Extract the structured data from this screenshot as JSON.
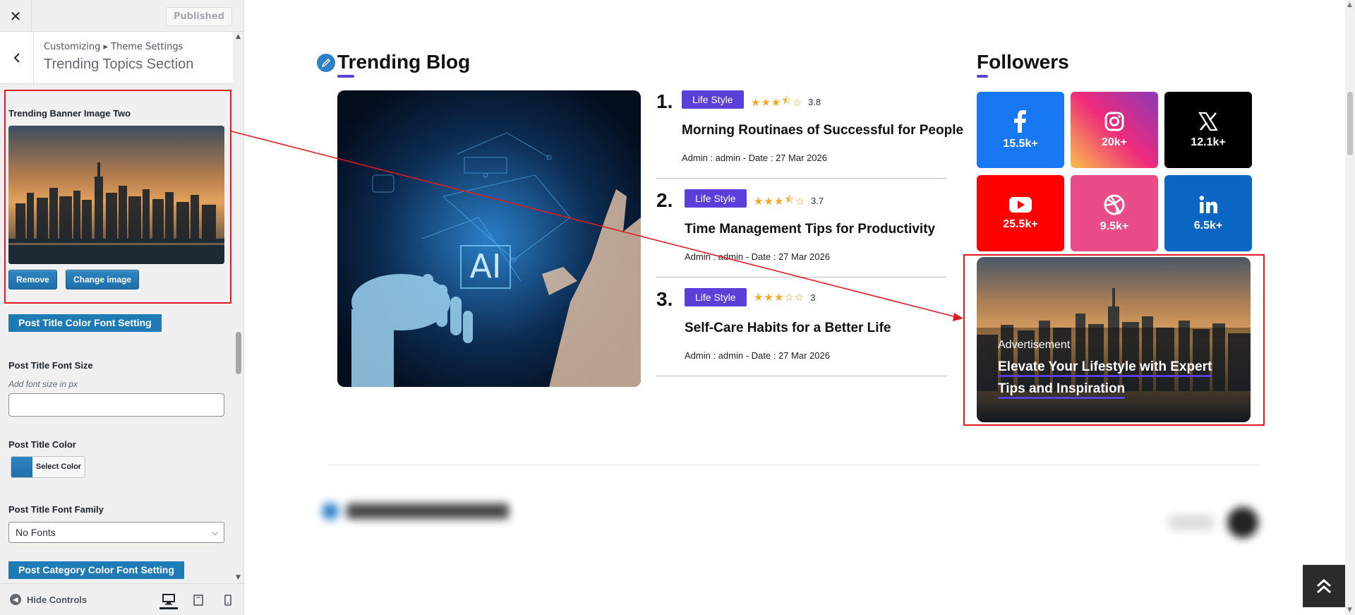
{
  "customizer": {
    "published_label": "Published",
    "breadcrumb": "Customizing ▸ Theme Settings",
    "section_title": "Trending Topics Section",
    "banner_label": "Trending Banner Image Two",
    "remove_label": "Remove",
    "change_image_label": "Change image",
    "post_title_color_font_setting": "Post Title Color Font Setting",
    "font_size_label": "Post Title Font Size",
    "font_size_desc": "Add font size in px",
    "font_size_value": "",
    "title_color_label": "Post Title Color",
    "select_color_label": "Select Color",
    "font_family_label": "Post Title Font Family",
    "font_family_value": "No Fonts",
    "post_category_color_font_setting": "Post Category Color Font Setting",
    "hide_controls_label": "Hide Controls"
  },
  "trending": {
    "heading": "Trending Blog",
    "posts": [
      {
        "num": "1.",
        "category": "Life Style",
        "rating": 3.8,
        "rating_text": "3.8",
        "title": "Morning Routinaes of Successful for People",
        "meta": "Admin : admin  -  Date : 27 Mar 2026"
      },
      {
        "num": "2.",
        "category": "Life Style",
        "rating": 3.7,
        "rating_text": "3.7",
        "title": "Time Management Tips for Productivity",
        "meta": "Admin : admin  -  Date : 27 Mar 2026"
      },
      {
        "num": "3.",
        "category": "Life Style",
        "rating": 3,
        "rating_text": "3",
        "title": "Self-Care Habits for a Better Life",
        "meta": "Admin : admin  -  Date : 27 Mar 2026"
      }
    ]
  },
  "followers": {
    "heading": "Followers",
    "items": [
      {
        "network": "facebook",
        "count": "15.5k+",
        "color": "#1877f2"
      },
      {
        "network": "instagram",
        "count": "20k+",
        "color": "#e1306c"
      },
      {
        "network": "x",
        "count": "12.1k+",
        "color": "#000000"
      },
      {
        "network": "youtube",
        "count": "25.5k+",
        "color": "#ff0000"
      },
      {
        "network": "dribbble",
        "count": "9.5k+",
        "color": "#ea4c89"
      },
      {
        "network": "linkedin",
        "count": "6.5k+",
        "color": "#0a66c2"
      }
    ]
  },
  "advertisement": {
    "label": "Advertisement",
    "title": "Elevate Your Lifestyle with Expert Tips and Inspiration"
  },
  "colors": {
    "accent": "#5b3fd9",
    "highlight": "#e01b24",
    "wp_blue": "#1f7bb6"
  }
}
